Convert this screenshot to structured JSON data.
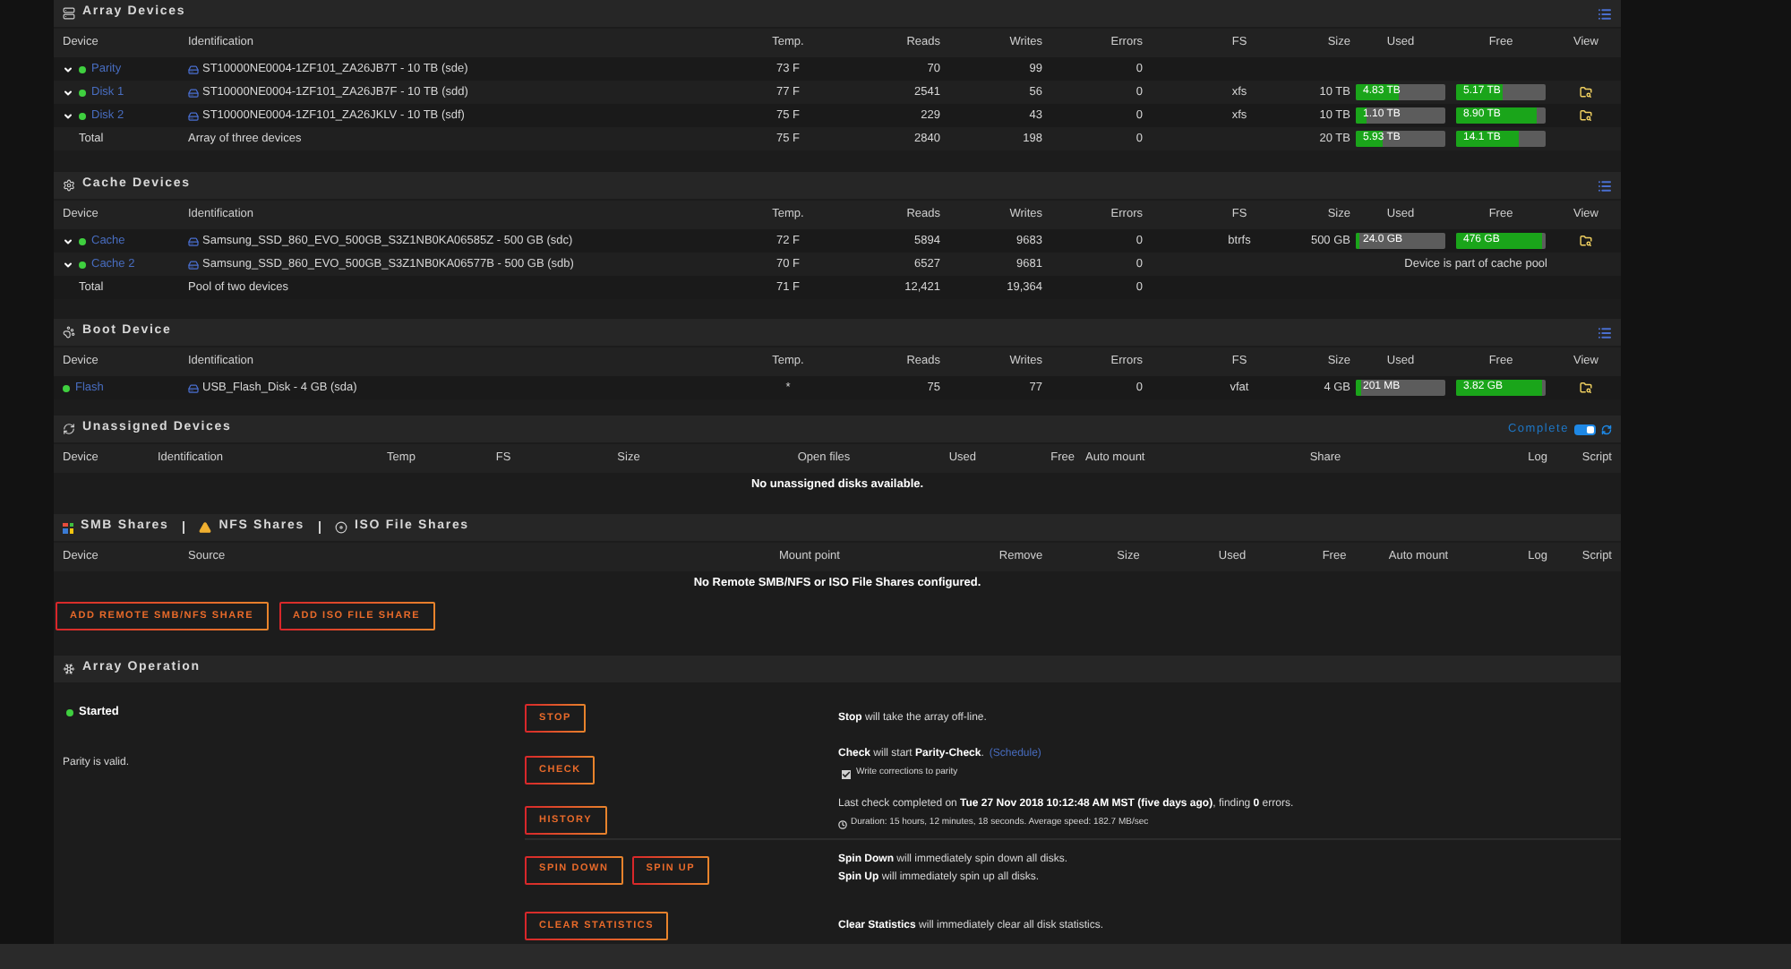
{
  "array_devices": {
    "title": "Array Devices",
    "columns": [
      "Device",
      "Identification",
      "Temp.",
      "Reads",
      "Writes",
      "Errors",
      "FS",
      "Size",
      "Used",
      "Free",
      "View"
    ],
    "rows": [
      {
        "kind": "device",
        "expandable": true,
        "name": "Parity",
        "identification": "ST10000NE0004-1ZF101_ZA26JB7T - 10 TB (sde)",
        "temp": "73 F",
        "reads": "70",
        "writes": "99",
        "errors": "0"
      },
      {
        "kind": "device",
        "expandable": true,
        "name": "Disk 1",
        "identification": "ST10000NE0004-1ZF101_ZA26JB7F - 10 TB (sdd)",
        "temp": "77 F",
        "reads": "2541",
        "writes": "56",
        "errors": "0",
        "fs": "xfs",
        "size": "10 TB",
        "used": {
          "text": "4.83 TB",
          "level": 0.483
        },
        "free": {
          "text": "5.17 TB",
          "level": 0.517
        },
        "view": true
      },
      {
        "kind": "device",
        "expandable": true,
        "name": "Disk 2",
        "identification": "ST10000NE0004-1ZF101_ZA26JKLV - 10 TB (sdf)",
        "temp": "75 F",
        "reads": "229",
        "writes": "43",
        "errors": "0",
        "fs": "xfs",
        "size": "10 TB",
        "used": {
          "text": "1.10 TB",
          "level": 0.11
        },
        "free": {
          "text": "8.90 TB",
          "level": 0.89
        },
        "view": true
      },
      {
        "kind": "total",
        "name": "Total",
        "identification": "Array of three devices",
        "temp": "75 F",
        "reads": "2840",
        "writes": "198",
        "errors": "0",
        "size": "20 TB",
        "used": {
          "text": "5.93 TB",
          "level": 0.2965
        },
        "free": {
          "text": "14.1 TB",
          "level": 0.705
        }
      }
    ]
  },
  "cache_devices": {
    "title": "Cache Devices",
    "columns": [
      "Device",
      "Identification",
      "Temp.",
      "Reads",
      "Writes",
      "Errors",
      "FS",
      "Size",
      "Used",
      "Free",
      "View"
    ],
    "rows": [
      {
        "kind": "device",
        "expandable": true,
        "name": "Cache",
        "identification": "Samsung_SSD_860_EVO_500GB_S3Z1NB0KA06585Z - 500 GB (sdc)",
        "temp": "72 F",
        "reads": "5894",
        "writes": "9683",
        "errors": "0",
        "fs": "btrfs",
        "size": "500 GB",
        "used": {
          "text": "24.0 GB",
          "level": 0.048
        },
        "free": {
          "text": "476 GB",
          "level": 0.952
        },
        "view": true
      },
      {
        "kind": "device",
        "expandable": true,
        "name": "Cache 2",
        "identification": "Samsung_SSD_860_EVO_500GB_S3Z1NB0KA06577B - 500 GB (sdb)",
        "temp": "70 F",
        "reads": "6527",
        "writes": "9681",
        "errors": "0",
        "note": "Device is part of cache pool"
      },
      {
        "kind": "total",
        "name": "Total",
        "identification": "Pool of two devices",
        "temp": "71 F",
        "reads": "12,421",
        "writes": "19,364",
        "errors": "0"
      }
    ]
  },
  "boot_device": {
    "title": "Boot Device",
    "columns": [
      "Device",
      "Identification",
      "Temp.",
      "Reads",
      "Writes",
      "Errors",
      "FS",
      "Size",
      "Used",
      "Free",
      "View"
    ],
    "rows": [
      {
        "kind": "device",
        "expandable": false,
        "name": "Flash",
        "identification": "USB_Flash_Disk - 4 GB (sda)",
        "temp": "*",
        "reads": "75",
        "writes": "77",
        "errors": "0",
        "fs": "vfat",
        "size": "4 GB",
        "used": {
          "text": "201 MB",
          "level": 0.05
        },
        "free": {
          "text": "3.82 GB",
          "level": 0.955
        },
        "view": true
      }
    ]
  },
  "unassigned_devices": {
    "title": "Unassigned Devices",
    "status": "Complete",
    "toggle_on": true,
    "columns": [
      "Device",
      "Identification",
      "Temp",
      "FS",
      "Size",
      "Open files",
      "Used",
      "Free",
      "Auto mount",
      "Share",
      "Log",
      "Script"
    ],
    "message": "No unassigned disks available."
  },
  "remote_shares": {
    "tabs": [
      "SMB Shares",
      "NFS Shares",
      "ISO File Shares"
    ],
    "columns": [
      "Device",
      "Source",
      "Mount point",
      "Remove",
      "Size",
      "Used",
      "Free",
      "Auto mount",
      "Log",
      "Script"
    ],
    "message": "No Remote SMB/NFS or ISO File Shares configured.",
    "buttons": [
      "ADD REMOTE SMB/NFS SHARE",
      "ADD ISO FILE SHARE"
    ]
  },
  "array_operation": {
    "title": "Array Operation",
    "state": "Started",
    "parity": "Parity is valid.",
    "stop": {
      "button": "STOP",
      "text": "**Stop** will take the array off-line."
    },
    "check": {
      "button": "CHECK",
      "text": "**Check** will start **Parity-Check**.",
      "link": "(Schedule)",
      "option": {
        "label": "Write corrections to parity",
        "checked": true
      }
    },
    "history": {
      "button": "HISTORY",
      "text": "Last check completed on **Tue 27 Nov 2018 10:12:48 AM MST (five days ago)**, finding **0** errors.",
      "duration": "Duration: 15 hours, 12 minutes, 18 seconds. Average speed: 182.7 MB/sec"
    },
    "spin": {
      "buttons": [
        "SPIN DOWN",
        "SPIN UP"
      ],
      "texts": [
        "**Spin Down** will immediately spin down all disks.",
        "**Spin Up** will immediately spin up all disks."
      ]
    },
    "clear": {
      "button": "CLEAR STATISTICS",
      "text": "**Clear Statistics** will immediately clear all disk statistics."
    }
  }
}
